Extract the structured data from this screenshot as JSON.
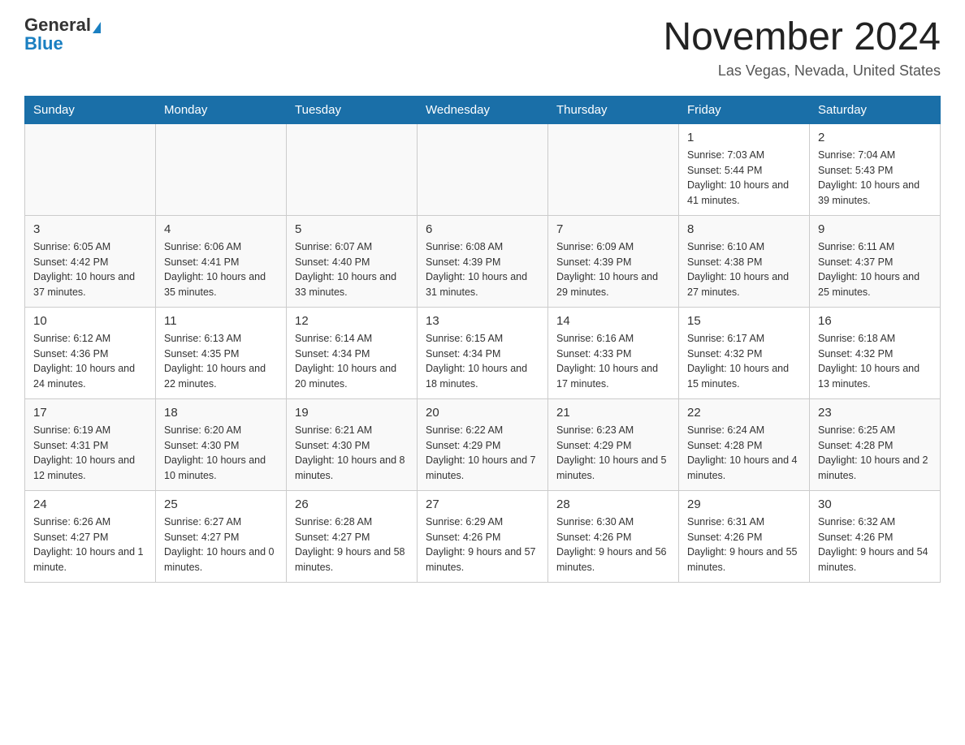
{
  "header": {
    "logo_general": "General",
    "logo_blue": "Blue",
    "month_title": "November 2024",
    "location": "Las Vegas, Nevada, United States"
  },
  "days_of_week": [
    "Sunday",
    "Monday",
    "Tuesday",
    "Wednesday",
    "Thursday",
    "Friday",
    "Saturday"
  ],
  "weeks": [
    {
      "days": [
        {
          "date": "",
          "info": ""
        },
        {
          "date": "",
          "info": ""
        },
        {
          "date": "",
          "info": ""
        },
        {
          "date": "",
          "info": ""
        },
        {
          "date": "",
          "info": ""
        },
        {
          "date": "1",
          "info": "Sunrise: 7:03 AM\nSunset: 5:44 PM\nDaylight: 10 hours and 41 minutes."
        },
        {
          "date": "2",
          "info": "Sunrise: 7:04 AM\nSunset: 5:43 PM\nDaylight: 10 hours and 39 minutes."
        }
      ]
    },
    {
      "days": [
        {
          "date": "3",
          "info": "Sunrise: 6:05 AM\nSunset: 4:42 PM\nDaylight: 10 hours and 37 minutes."
        },
        {
          "date": "4",
          "info": "Sunrise: 6:06 AM\nSunset: 4:41 PM\nDaylight: 10 hours and 35 minutes."
        },
        {
          "date": "5",
          "info": "Sunrise: 6:07 AM\nSunset: 4:40 PM\nDaylight: 10 hours and 33 minutes."
        },
        {
          "date": "6",
          "info": "Sunrise: 6:08 AM\nSunset: 4:39 PM\nDaylight: 10 hours and 31 minutes."
        },
        {
          "date": "7",
          "info": "Sunrise: 6:09 AM\nSunset: 4:39 PM\nDaylight: 10 hours and 29 minutes."
        },
        {
          "date": "8",
          "info": "Sunrise: 6:10 AM\nSunset: 4:38 PM\nDaylight: 10 hours and 27 minutes."
        },
        {
          "date": "9",
          "info": "Sunrise: 6:11 AM\nSunset: 4:37 PM\nDaylight: 10 hours and 25 minutes."
        }
      ]
    },
    {
      "days": [
        {
          "date": "10",
          "info": "Sunrise: 6:12 AM\nSunset: 4:36 PM\nDaylight: 10 hours and 24 minutes."
        },
        {
          "date": "11",
          "info": "Sunrise: 6:13 AM\nSunset: 4:35 PM\nDaylight: 10 hours and 22 minutes."
        },
        {
          "date": "12",
          "info": "Sunrise: 6:14 AM\nSunset: 4:34 PM\nDaylight: 10 hours and 20 minutes."
        },
        {
          "date": "13",
          "info": "Sunrise: 6:15 AM\nSunset: 4:34 PM\nDaylight: 10 hours and 18 minutes."
        },
        {
          "date": "14",
          "info": "Sunrise: 6:16 AM\nSunset: 4:33 PM\nDaylight: 10 hours and 17 minutes."
        },
        {
          "date": "15",
          "info": "Sunrise: 6:17 AM\nSunset: 4:32 PM\nDaylight: 10 hours and 15 minutes."
        },
        {
          "date": "16",
          "info": "Sunrise: 6:18 AM\nSunset: 4:32 PM\nDaylight: 10 hours and 13 minutes."
        }
      ]
    },
    {
      "days": [
        {
          "date": "17",
          "info": "Sunrise: 6:19 AM\nSunset: 4:31 PM\nDaylight: 10 hours and 12 minutes."
        },
        {
          "date": "18",
          "info": "Sunrise: 6:20 AM\nSunset: 4:30 PM\nDaylight: 10 hours and 10 minutes."
        },
        {
          "date": "19",
          "info": "Sunrise: 6:21 AM\nSunset: 4:30 PM\nDaylight: 10 hours and 8 minutes."
        },
        {
          "date": "20",
          "info": "Sunrise: 6:22 AM\nSunset: 4:29 PM\nDaylight: 10 hours and 7 minutes."
        },
        {
          "date": "21",
          "info": "Sunrise: 6:23 AM\nSunset: 4:29 PM\nDaylight: 10 hours and 5 minutes."
        },
        {
          "date": "22",
          "info": "Sunrise: 6:24 AM\nSunset: 4:28 PM\nDaylight: 10 hours and 4 minutes."
        },
        {
          "date": "23",
          "info": "Sunrise: 6:25 AM\nSunset: 4:28 PM\nDaylight: 10 hours and 2 minutes."
        }
      ]
    },
    {
      "days": [
        {
          "date": "24",
          "info": "Sunrise: 6:26 AM\nSunset: 4:27 PM\nDaylight: 10 hours and 1 minute."
        },
        {
          "date": "25",
          "info": "Sunrise: 6:27 AM\nSunset: 4:27 PM\nDaylight: 10 hours and 0 minutes."
        },
        {
          "date": "26",
          "info": "Sunrise: 6:28 AM\nSunset: 4:27 PM\nDaylight: 9 hours and 58 minutes."
        },
        {
          "date": "27",
          "info": "Sunrise: 6:29 AM\nSunset: 4:26 PM\nDaylight: 9 hours and 57 minutes."
        },
        {
          "date": "28",
          "info": "Sunrise: 6:30 AM\nSunset: 4:26 PM\nDaylight: 9 hours and 56 minutes."
        },
        {
          "date": "29",
          "info": "Sunrise: 6:31 AM\nSunset: 4:26 PM\nDaylight: 9 hours and 55 minutes."
        },
        {
          "date": "30",
          "info": "Sunrise: 6:32 AM\nSunset: 4:26 PM\nDaylight: 9 hours and 54 minutes."
        }
      ]
    }
  ]
}
